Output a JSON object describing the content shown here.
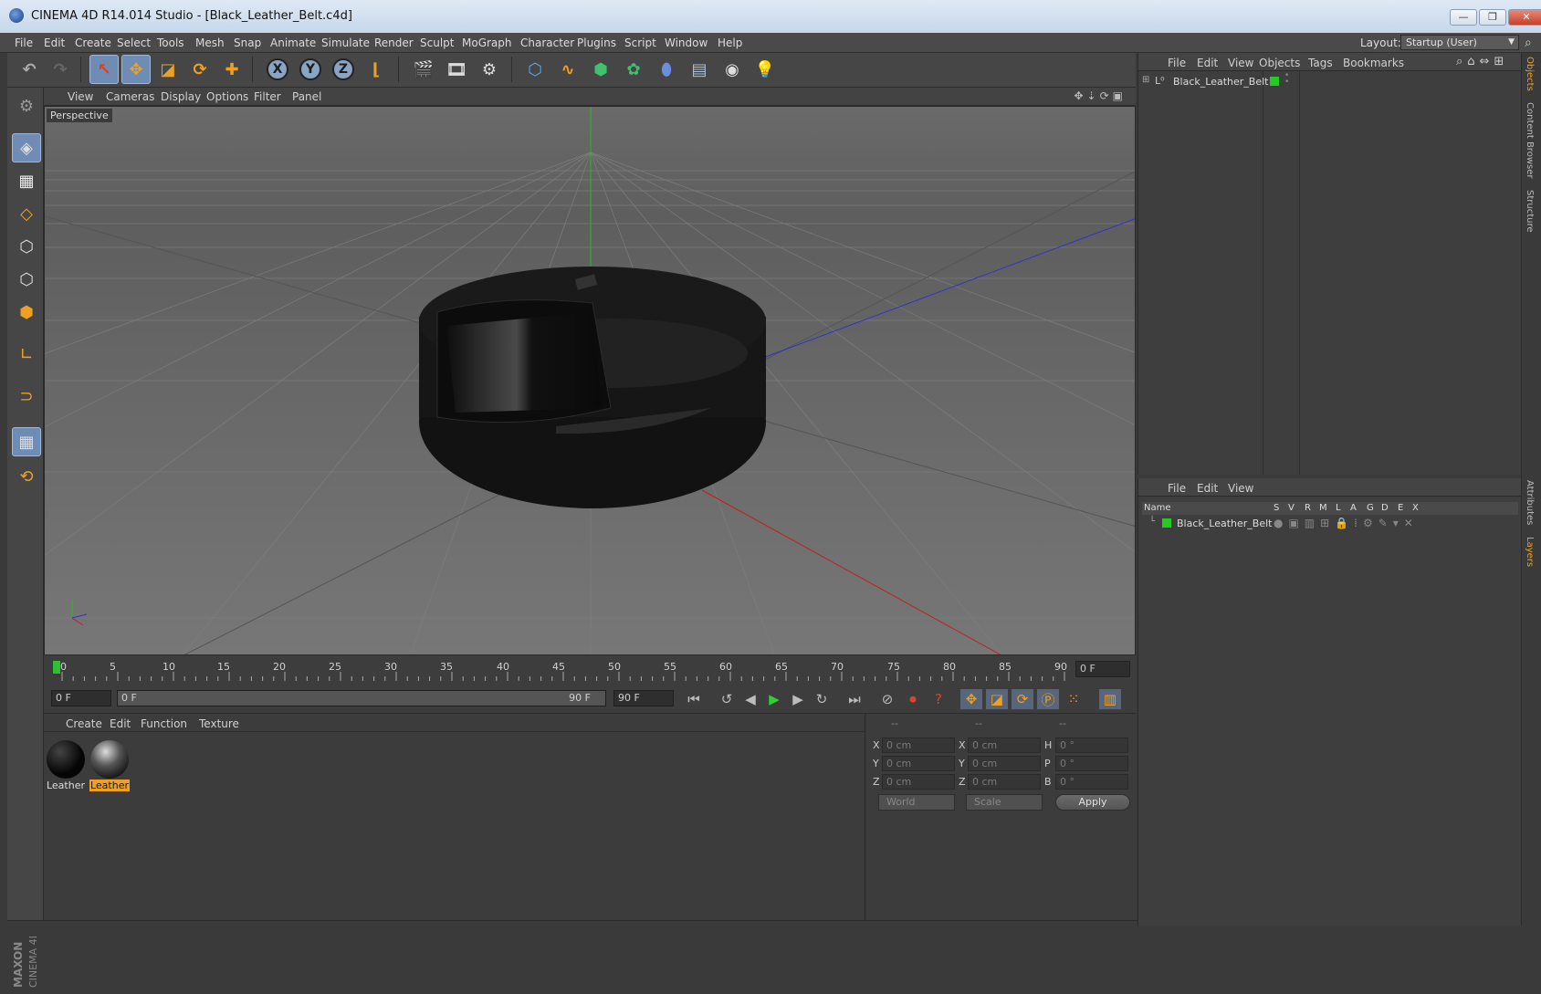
{
  "window": {
    "title": "CINEMA 4D R14.014 Studio - [Black_Leather_Belt.c4d]",
    "minimize": "—",
    "restore": "❐",
    "close": "✕"
  },
  "menubar": {
    "items": [
      "File",
      "Edit",
      "Create",
      "Select",
      "Tools",
      "Mesh",
      "Snap",
      "Animate",
      "Simulate",
      "Render",
      "Sculpt",
      "MoGraph",
      "Character",
      "Plugins",
      "Script",
      "Window",
      "Help"
    ],
    "layout_label": "Layout:",
    "layout_value": "Startup (User)"
  },
  "toolbar": {
    "axis_x": "X",
    "axis_y": "Y",
    "axis_z": "Z"
  },
  "viewport": {
    "menu": [
      "View",
      "Cameras",
      "Display",
      "Options",
      "Filter",
      "Panel"
    ],
    "label": "Perspective"
  },
  "timeline": {
    "ticks": [
      "0",
      "5",
      "10",
      "15",
      "20",
      "25",
      "30",
      "35",
      "40",
      "45",
      "50",
      "55",
      "60",
      "65",
      "70",
      "75",
      "80",
      "85",
      "90"
    ],
    "current_frame": "0 F"
  },
  "playbar": {
    "start": "0 F",
    "range_start": "0 F",
    "range_end": "90 F",
    "end": "90 F"
  },
  "materials": {
    "menu": [
      "Create",
      "Edit",
      "Function",
      "Texture"
    ],
    "items": [
      {
        "name": "Leather",
        "selected": false
      },
      {
        "name": "Leather",
        "selected": true
      }
    ]
  },
  "coordinates": {
    "headers": [
      "--",
      "--",
      "--"
    ],
    "rows": [
      {
        "a": "X",
        "av": "0 cm",
        "b": "X",
        "bv": "0 cm",
        "c": "H",
        "cv": "0 °"
      },
      {
        "a": "Y",
        "av": "0 cm",
        "b": "Y",
        "bv": "0 cm",
        "c": "P",
        "cv": "0 °"
      },
      {
        "a": "Z",
        "av": "0 cm",
        "b": "Z",
        "bv": "0 cm",
        "c": "B",
        "cv": "0 °"
      }
    ],
    "mode": "World",
    "type": "Scale",
    "apply": "Apply"
  },
  "objects": {
    "menu": [
      "File",
      "Edit",
      "View",
      "Objects",
      "Tags",
      "Bookmarks"
    ],
    "items": [
      {
        "name": "Black_Leather_Belt"
      }
    ]
  },
  "layers": {
    "menu": [
      "File",
      "Edit",
      "View"
    ],
    "columns": [
      "Name",
      "S",
      "V",
      "R",
      "M",
      "L",
      "A",
      "G",
      "D",
      "E",
      "X"
    ],
    "items": [
      {
        "name": "Black_Leather_Belt"
      }
    ]
  },
  "right_tabs": [
    "Objects",
    "Content Browser",
    "Structure",
    "Attributes",
    "Layers"
  ],
  "branding": {
    "line1": "MAXON",
    "line2": "CINEMA 4D"
  },
  "colors": {
    "accent": "#f0a020",
    "selection": "#6f8cb5",
    "layer_green": "#22cc22"
  }
}
